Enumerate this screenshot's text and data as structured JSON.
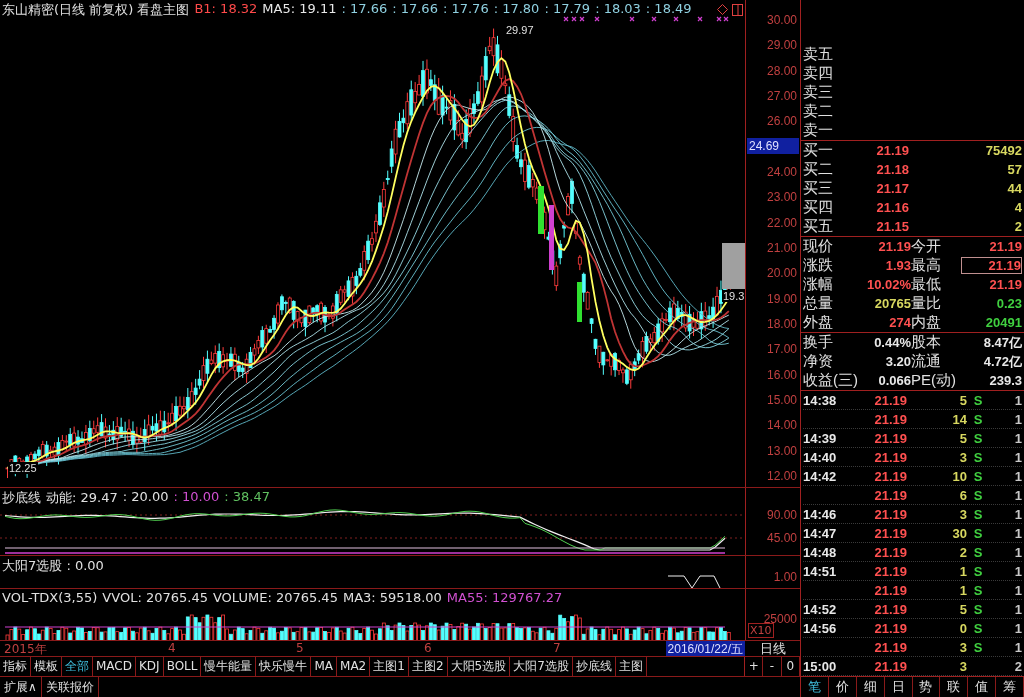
{
  "main_chart": {
    "title": "东山精密(日线 前复权) 看盘主图",
    "legend": [
      {
        "text": "B1: 18.32",
        "color": "#ff4a4a"
      },
      {
        "text": "MA5: 19.11",
        "color": "#e8e8e8"
      },
      {
        "text": ": 17.66",
        "color": "#8fd0e0"
      },
      {
        "text": ": 17.66",
        "color": "#8fd0e0"
      },
      {
        "text": ": 17.76",
        "color": "#8fd0e0"
      },
      {
        "text": ": 17.80",
        "color": "#8fd0e0"
      },
      {
        "text": ": 17.79",
        "color": "#8fd0e0"
      },
      {
        "text": ": 18.03",
        "color": "#8fd0e0"
      },
      {
        "text": ": 18.49",
        "color": "#8fd0e0"
      }
    ],
    "labels": [
      "29.97",
      "19.3",
      "12.25"
    ]
  },
  "price_axis": {
    "ticks_upper": [
      "30.00",
      "29.00",
      "28.00",
      "27.00",
      "26.00"
    ],
    "ticks_lower": [
      "24.00",
      "23.00",
      "22.00",
      "21.00",
      "20.00",
      "19.00",
      "18.00",
      "17.00",
      "16.00",
      "15.00",
      "14.00",
      "13.00",
      "12.00"
    ],
    "marker": "24.69"
  },
  "indicator_1": {
    "name": "抄底线",
    "legend": [
      {
        "text": "动能: 29.47",
        "color": "#e0e0e0"
      },
      {
        "text": ": 20.00",
        "color": "#e0e0e0"
      },
      {
        "text": ": 10.00",
        "color": "#d050d0"
      },
      {
        "text": ": 38.47",
        "color": "#60c060"
      }
    ],
    "ticks": [
      "90.00",
      "45.00"
    ]
  },
  "indicator_2": {
    "legend": [
      {
        "text": "大阳7选股 : 0.00",
        "color": "#e0e0e0"
      }
    ],
    "ticks": [
      "1.00"
    ]
  },
  "volume": {
    "legend": [
      {
        "text": "VOL-TDX(3,55)",
        "color": "#e0e0e0"
      },
      {
        "text": "VVOL: 20765.45",
        "color": "#e0e0e0"
      },
      {
        "text": "VOLUME: 20765.45",
        "color": "#e0e0e0"
      },
      {
        "text": "MA3: 59518.00",
        "color": "#e0e0e0"
      },
      {
        "text": "MA55: 129767.27",
        "color": "#d050d0"
      }
    ],
    "ticks": [
      "25000"
    ],
    "scale": "X10"
  },
  "date_axis": {
    "labels": [
      "2015年",
      "4",
      "5",
      "6",
      "7"
    ],
    "cursor_date": "2016/01/22/五"
  },
  "period": "日线",
  "zoom_buttons": [
    "+",
    "-",
    "0"
  ],
  "tabs": [
    {
      "label": "指标",
      "selected": false
    },
    {
      "label": "模板",
      "selected": false
    },
    {
      "label": "全部",
      "selected": true
    },
    {
      "label": "MACD",
      "selected": false
    },
    {
      "label": "KDJ",
      "selected": false
    },
    {
      "label": "BOLL",
      "selected": false
    },
    {
      "label": "慢牛能量",
      "selected": false
    },
    {
      "label": "快乐慢牛",
      "selected": false
    },
    {
      "label": "MA",
      "selected": false
    },
    {
      "label": "MA2",
      "selected": false
    },
    {
      "label": "主图1",
      "selected": false
    },
    {
      "label": "主图2",
      "selected": false
    },
    {
      "label": "大阳5选股",
      "selected": false
    },
    {
      "label": "大阳7选股",
      "selected": false
    },
    {
      "label": "抄底线",
      "selected": false
    },
    {
      "label": "主图",
      "selected": false
    }
  ],
  "bottom_tabs": [
    "扩展∧",
    "关联报价"
  ],
  "order_book": {
    "asks": [
      {
        "label": "卖五"
      },
      {
        "label": "卖四"
      },
      {
        "label": "卖三"
      },
      {
        "label": "卖二"
      },
      {
        "label": "卖一"
      }
    ],
    "bids": [
      {
        "label": "买一",
        "price": "21.19",
        "volume": "75492"
      },
      {
        "label": "买二",
        "price": "21.18",
        "volume": "57"
      },
      {
        "label": "买三",
        "price": "21.17",
        "volume": "44"
      },
      {
        "label": "买四",
        "price": "21.16",
        "volume": "4"
      },
      {
        "label": "买五",
        "price": "21.15",
        "volume": "2"
      }
    ]
  },
  "quote": [
    {
      "label": "现价",
      "value": "21.19",
      "color": "#ff5050",
      "highlighted": false
    },
    {
      "label": "今开",
      "value": "21.19",
      "color": "#ff5050",
      "highlighted": false
    },
    {
      "label": "涨跌",
      "value": "1.93",
      "color": "#ff5050",
      "highlighted": false
    },
    {
      "label": "最高",
      "value": "21.19",
      "color": "#ff5050",
      "highlighted": true
    },
    {
      "label": "涨幅",
      "value": "10.02%",
      "color": "#ff5050",
      "highlighted": false
    },
    {
      "label": "最低",
      "value": "21.19",
      "color": "#ff5050",
      "highlighted": false
    },
    {
      "label": "总量",
      "value": "20765",
      "color": "#d8d860",
      "highlighted": false
    },
    {
      "label": "量比",
      "value": "0.23",
      "color": "#40d040",
      "highlighted": false
    },
    {
      "label": "外盘",
      "value": "274",
      "color": "#ff5050",
      "highlighted": false
    },
    {
      "label": "内盘",
      "value": "20491",
      "color": "#40d040",
      "highlighted": false
    }
  ],
  "fundamentals": [
    {
      "label": "换手",
      "value": "0.44%"
    },
    {
      "label": "股本",
      "value": "8.47亿"
    },
    {
      "label": "净资",
      "value": "3.20"
    },
    {
      "label": "流通",
      "value": "4.72亿"
    },
    {
      "label": "收益(三)",
      "value": "0.066"
    },
    {
      "label": "PE(动)",
      "value": "239.3"
    }
  ],
  "trades": [
    {
      "time": "14:38",
      "price": "21.19",
      "volume": "5",
      "side": "S",
      "count": "1"
    },
    {
      "price": "21.19",
      "volume": "14",
      "side": "S",
      "count": "1"
    },
    {
      "time": "14:39",
      "price": "21.19",
      "volume": "5",
      "side": "S",
      "count": "1"
    },
    {
      "time": "14:40",
      "price": "21.19",
      "volume": "3",
      "side": "S",
      "count": "1"
    },
    {
      "time": "14:42",
      "price": "21.19",
      "volume": "10",
      "side": "S",
      "count": "1"
    },
    {
      "price": "21.19",
      "volume": "6",
      "side": "S",
      "count": "1"
    },
    {
      "time": "14:46",
      "price": "21.19",
      "volume": "3",
      "side": "S",
      "count": "1"
    },
    {
      "time": "14:47",
      "price": "21.19",
      "volume": "30",
      "side": "S",
      "count": "1"
    },
    {
      "time": "14:48",
      "price": "21.19",
      "volume": "2",
      "side": "S",
      "count": "1"
    },
    {
      "time": "14:51",
      "price": "21.19",
      "volume": "1",
      "side": "S",
      "count": "1"
    },
    {
      "price": "21.19",
      "volume": "1",
      "side": "S",
      "count": "1"
    },
    {
      "time": "14:52",
      "price": "21.19",
      "volume": "5",
      "side": "S",
      "count": "1"
    },
    {
      "time": "14:56",
      "price": "21.19",
      "volume": "0",
      "side": "S",
      "count": "1"
    },
    {
      "price": "21.19",
      "volume": "3",
      "side": "S",
      "count": "1"
    },
    {
      "time": "15:00",
      "price": "21.19",
      "volume": "3",
      "count": "2"
    }
  ],
  "panel_tabs": [
    {
      "label": "笔",
      "selected": true
    },
    {
      "label": "价",
      "selected": false
    },
    {
      "label": "细",
      "selected": false
    },
    {
      "label": "日",
      "selected": false
    },
    {
      "label": "势",
      "selected": false
    },
    {
      "label": "联",
      "selected": false
    },
    {
      "label": "值",
      "selected": false
    },
    {
      "label": "筹",
      "selected": false
    }
  ]
}
